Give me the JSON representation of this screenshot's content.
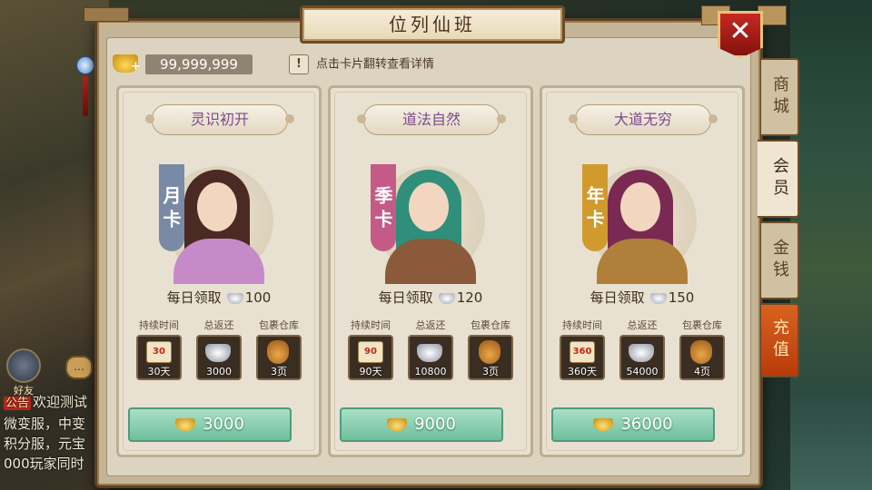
{
  "title": "位列仙班",
  "close_label": "✕",
  "gold_balance": "99,999,999",
  "hint_icon": "!",
  "hint_text": "点击卡片翻转查看详情",
  "tabs": [
    "商城",
    "会员",
    "金钱",
    "充值"
  ],
  "chat": {
    "tag": "公告",
    "lines": [
      "欢迎测试",
      "微变服，中变",
      "积分服，元宝",
      "000玩家同时"
    ]
  },
  "friend_label": "好友",
  "cards": [
    {
      "title": "灵识初开",
      "ribbon": "月卡",
      "daily_label": "每日领取",
      "daily_amount": "100",
      "stat_labels": [
        "持续时间",
        "总返还",
        "包裹仓库"
      ],
      "scroll_number": "30",
      "duration": "30天",
      "total_return": "3000",
      "bag": "3页",
      "price": "3000"
    },
    {
      "title": "道法自然",
      "ribbon": "季卡",
      "daily_label": "每日领取",
      "daily_amount": "120",
      "stat_labels": [
        "持续时间",
        "总返还",
        "包裹仓库"
      ],
      "scroll_number": "90",
      "duration": "90天",
      "total_return": "10800",
      "bag": "3页",
      "price": "9000"
    },
    {
      "title": "大道无穷",
      "ribbon": "年卡",
      "daily_label": "每日领取",
      "daily_amount": "150",
      "stat_labels": [
        "持续时间",
        "总返还",
        "包裹仓库"
      ],
      "scroll_number": "360",
      "duration": "360天",
      "total_return": "54000",
      "bag": "4页",
      "price": "36000"
    }
  ],
  "colors": {
    "ribbon_month": "#7a8aa6",
    "ribbon_season": "#c45a86",
    "ribbon_year": "#d09a2c",
    "buy_button": "#8fd1b3",
    "recharge_tab": "#c94d14"
  }
}
